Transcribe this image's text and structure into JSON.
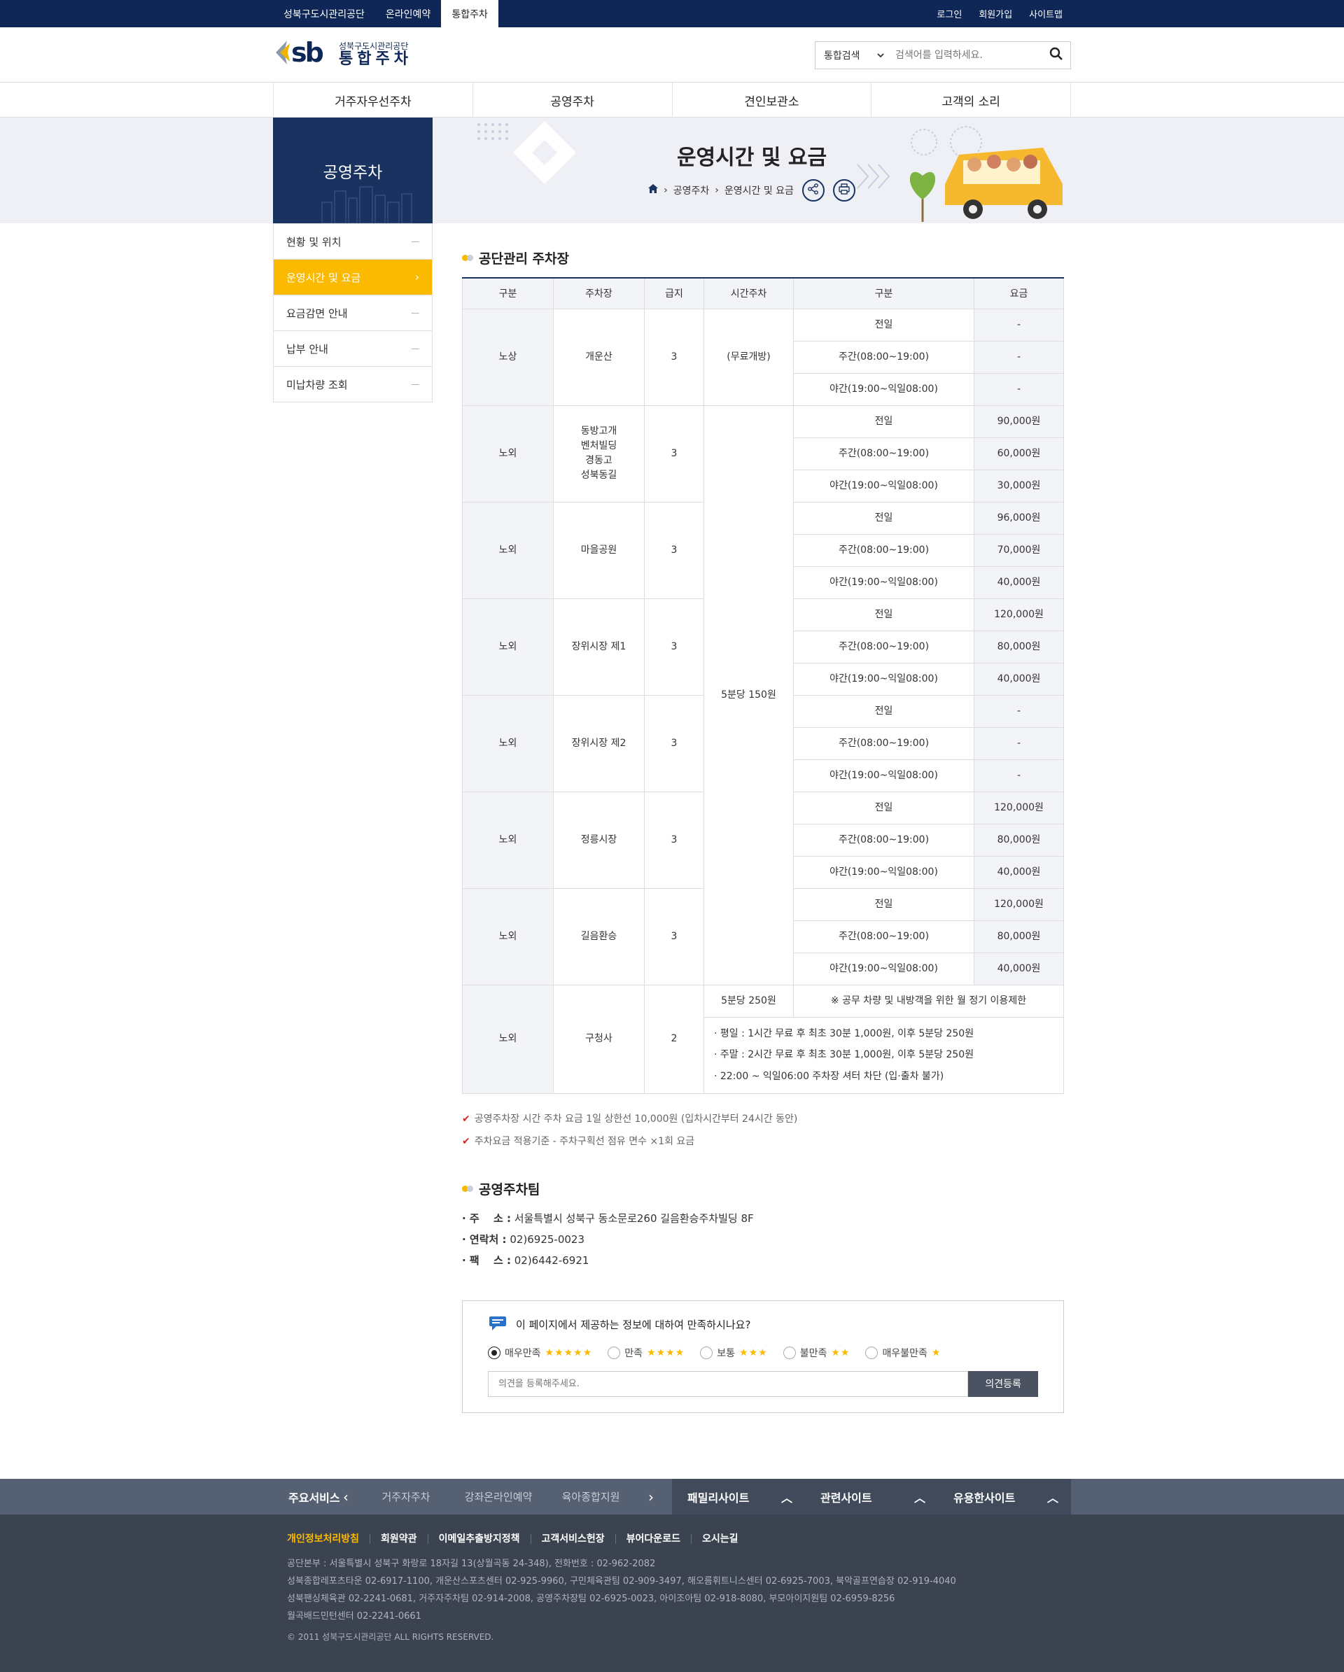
{
  "topbar": {
    "left": [
      "성북구도시관리공단",
      "온라인예약",
      "통합주차"
    ],
    "right": [
      "로그인",
      "회원가입",
      "사이트맵"
    ]
  },
  "header": {
    "logo_sub": "성북구도시관리공단",
    "logo_main": "통합주차",
    "search_select": "통합검색",
    "search_placeholder": "검색어를 입력하세요."
  },
  "gnb": [
    "거주자우선주차",
    "공영주차",
    "견인보관소",
    "고객의 소리"
  ],
  "subvisual": {
    "lnb_title": "공영주차",
    "page_title": "운영시간 및 요금",
    "breadcrumb": [
      "공영주차",
      "운영시간 및 요금"
    ]
  },
  "side_menu": [
    "현황 및 위치",
    "운영시간 및 요금",
    "요금감면 안내",
    "납부 안내",
    "미납차량 조회"
  ],
  "section1_title": "공단관리 주차장",
  "table": {
    "headers": [
      "구분",
      "주차장",
      "급지",
      "시간주차",
      "구분",
      "요금"
    ],
    "rows": [
      {
        "type": "노상",
        "name": "개운산",
        "grade": "3",
        "hourly": "(무료개방)",
        "fees": [
          [
            "전일",
            "-"
          ],
          [
            "주간(08:00~19:00)",
            "-"
          ],
          [
            "야간(19:00~익일08:00)",
            "-"
          ]
        ]
      },
      {
        "type": "노외",
        "name": "동방고개\n벤처빌딩\n경동고\n성북동길",
        "grade": "3",
        "fees": [
          [
            "전일",
            "90,000원"
          ],
          [
            "주간(08:00~19:00)",
            "60,000원"
          ],
          [
            "야간(19:00~익일08:00)",
            "30,000원"
          ]
        ]
      },
      {
        "type": "노외",
        "name": "마을공원",
        "grade": "3",
        "fees": [
          [
            "전일",
            "96,000원"
          ],
          [
            "주간(08:00~19:00)",
            "70,000원"
          ],
          [
            "야간(19:00~익일08:00)",
            "40,000원"
          ]
        ]
      },
      {
        "type": "노외",
        "name": "장위시장 제1",
        "grade": "3",
        "fees": [
          [
            "전일",
            "120,000원"
          ],
          [
            "주간(08:00~19:00)",
            "80,000원"
          ],
          [
            "야간(19:00~익일08:00)",
            "40,000원"
          ]
        ]
      },
      {
        "type": "노외",
        "name": "장위시장 제2",
        "grade": "3",
        "fees": [
          [
            "전일",
            "-"
          ],
          [
            "주간(08:00~19:00)",
            "-"
          ],
          [
            "야간(19:00~익일08:00)",
            "-"
          ]
        ]
      },
      {
        "type": "노외",
        "name": "정릉시장",
        "grade": "3",
        "fees": [
          [
            "전일",
            "120,000원"
          ],
          [
            "주간(08:00~19:00)",
            "80,000원"
          ],
          [
            "야간(19:00~익일08:00)",
            "40,000원"
          ]
        ]
      },
      {
        "type": "노외",
        "name": "길음환승",
        "grade": "3",
        "fees": [
          [
            "전일",
            "120,000원"
          ],
          [
            "주간(08:00~19:00)",
            "80,000원"
          ],
          [
            "야간(19:00~익일08:00)",
            "40,000원"
          ]
        ]
      }
    ],
    "shared_hourly": "5분당 150원",
    "last": {
      "type": "노외",
      "name": "구청사",
      "grade": "2",
      "hourly": "5분당 250원",
      "notice": "※ 공무 차량 및 내방객을 위한 월 정기 이용제한",
      "lines": [
        "· 평일 : 1시간 무료 후 최초 30분 1,000원, 이후 5분당 250원",
        "· 주말 : 2시간 무료 후 최초 30분 1,000원, 이후 5분당 250원",
        "· 22:00 ~ 익일06:00 주차장 셔터 차단 (입·출차 불가)"
      ]
    }
  },
  "notes": [
    "공영주차장 시간 주차 요금 1일 상한선 10,000원 (입차시간부터 24시간 동안)",
    "주차요금 적용기준 - 주차구획선 점유 면수 ×1회 요금"
  ],
  "team": {
    "title": "공영주차팀",
    "items": [
      {
        "label": "· 주　 소 :",
        "value": " 서울특별시 성북구 동소문로260 길음환승주차빌딩 8F"
      },
      {
        "label": "· 연락처 :",
        "value": " 02)6925-0023"
      },
      {
        "label": "· 팩　 스 :",
        "value": " 02)6442-6921"
      }
    ]
  },
  "survey": {
    "question": "이 페이지에서 제공하는 정보에 대하여 만족하시나요?",
    "options": [
      {
        "label": "매우만족",
        "stars": "★★★★★"
      },
      {
        "label": "만족",
        "stars": "★★★★"
      },
      {
        "label": "보통",
        "stars": "★★★"
      },
      {
        "label": "불만족",
        "stars": "★★"
      },
      {
        "label": "매우불만족",
        "stars": "★"
      }
    ],
    "placeholder": "의견을 등록해주세요.",
    "submit": "의견등록"
  },
  "footer_bar": {
    "services_title": "주요서비스",
    "services": [
      "거주자주차",
      "강좌온라인예약",
      "육아종합지원"
    ],
    "family": [
      "패밀리사이트",
      "관련사이트",
      "유용한사이트"
    ]
  },
  "footer": {
    "links": [
      "개인정보처리방침",
      "회원약관",
      "이메일추출방지정책",
      "고객서비스헌장",
      "뷰어다운로드",
      "오시는길"
    ],
    "info": [
      "공단본부 : 서울특별시 성북구 화랑로 18자길 13(상월곡동 24-348), 전화번호 : 02-962-2082",
      "성북종합레포츠타운 02-6917-1100, 개운산스포츠센터 02-925-9960, 구민체육관팀 02-909-3497, 해오름휘트니스센터 02-6925-7003, 북악골프연습장 02-919-4040",
      "성북팬싱체육관 02-2241-0681, 거주자주차팀 02-914-2008, 공영주차장팀 02-6925-0023, 아이조아팀 02-918-8080, 부모아이지원팀 02-6959-8256",
      "월곡배드민턴센터 02-2241-0661"
    ],
    "copyright": "© 2011 성북구도시관리공단 ALL RIGHTS RESERVED."
  },
  "colors": {
    "navy": "#0f2756",
    "accent": "#fbb900",
    "footer": "#3b4350"
  }
}
